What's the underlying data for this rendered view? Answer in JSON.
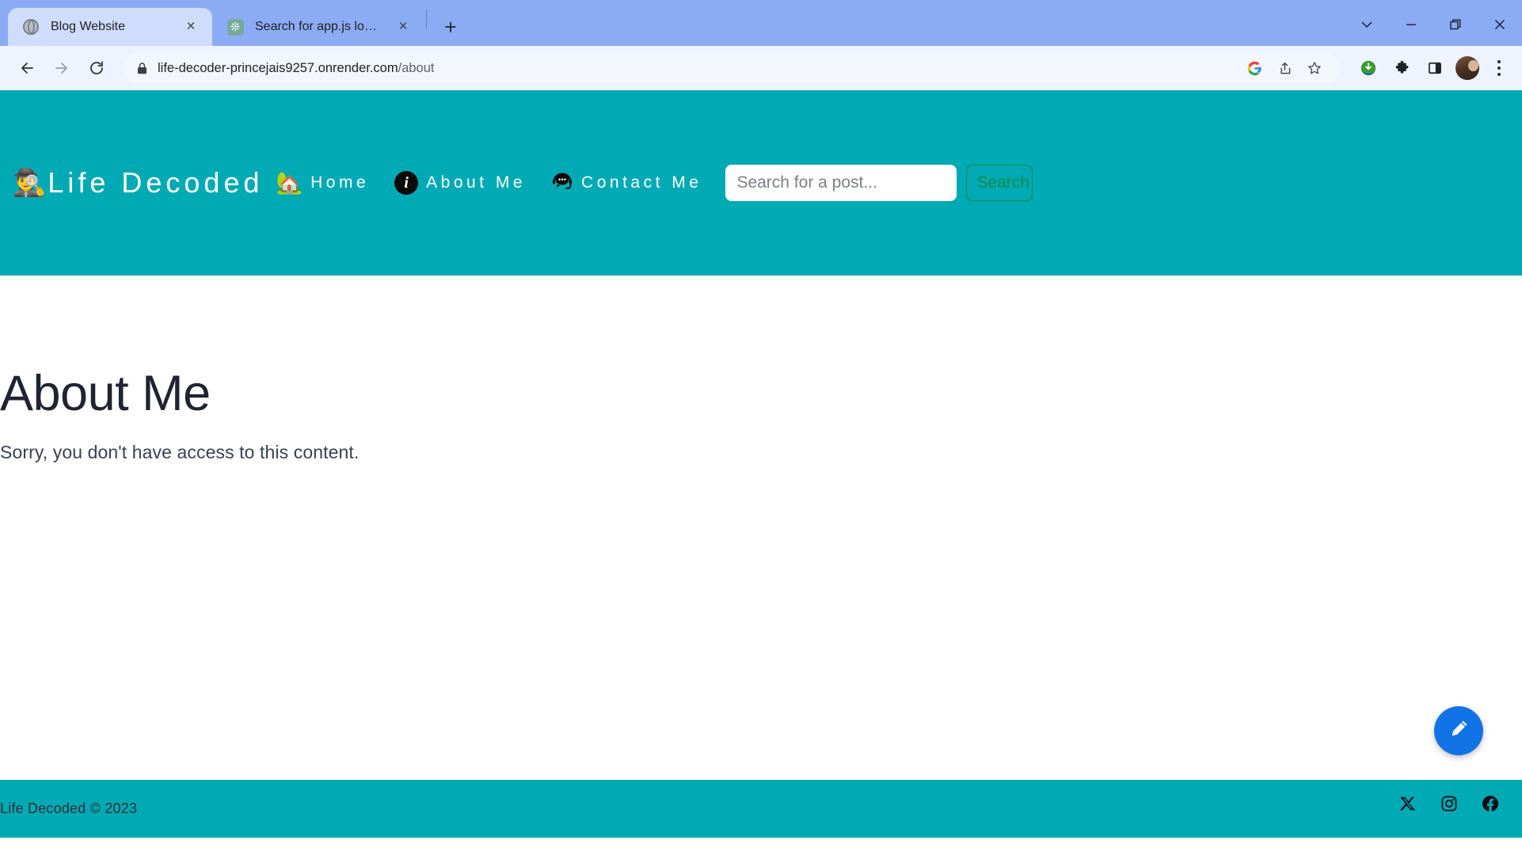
{
  "browser": {
    "tabs": [
      {
        "title": "Blog Website",
        "favicon": "globe-icon",
        "active": true,
        "close_label": "×"
      },
      {
        "title": "Search for app.js location",
        "favicon": "chatgpt-icon",
        "active": false,
        "close_label": "×"
      }
    ],
    "new_tab_label": "+",
    "window_controls": {
      "tab_search": "chevron-down-icon",
      "minimize": "minimize-icon",
      "maximize": "maximize-icon",
      "close": "close-icon"
    },
    "toolbar": {
      "back": "back-arrow-icon",
      "forward": "forward-arrow-icon",
      "reload": "reload-icon",
      "lock": "lock-icon",
      "url_host": "life-decoder-princejais9257.onrender.com",
      "url_path": "/about",
      "google_lens": "google-icon",
      "share": "share-icon",
      "bookmark": "star-icon",
      "idm_extension": "idm-icon",
      "extensions": "puzzle-icon",
      "side_panel": "side-panel-icon",
      "profile": "profile-avatar",
      "menu": "three-dot-menu-icon"
    }
  },
  "site": {
    "header": {
      "brand_emoji": "🕵️‍♂️",
      "brand_name": "Life Decoded",
      "nav": [
        {
          "icon": "house-with-garden-emoji",
          "glyph": "🏡",
          "label": "Home"
        },
        {
          "icon": "info-circle-icon",
          "glyph": "i",
          "label": "About Me"
        },
        {
          "icon": "headset-chat-icon",
          "glyph": "🗣",
          "label": "Contact Me"
        }
      ],
      "search": {
        "placeholder": "Search for a post...",
        "value": "",
        "button_label": "Search"
      }
    },
    "main": {
      "title": "About Me",
      "message": "Sorry, you don't have access to this content."
    },
    "fab": {
      "icon": "pencil-edit-icon",
      "color": "#1273e6"
    },
    "footer": {
      "copyright": "Life Decoded © 2023",
      "socials": [
        {
          "name": "x-twitter-icon"
        },
        {
          "name": "instagram-icon"
        },
        {
          "name": "facebook-icon"
        }
      ]
    },
    "colors": {
      "teal": "#00aab4",
      "accent_blue": "#1273e6",
      "search_button_green": "#0f8a4a"
    }
  }
}
